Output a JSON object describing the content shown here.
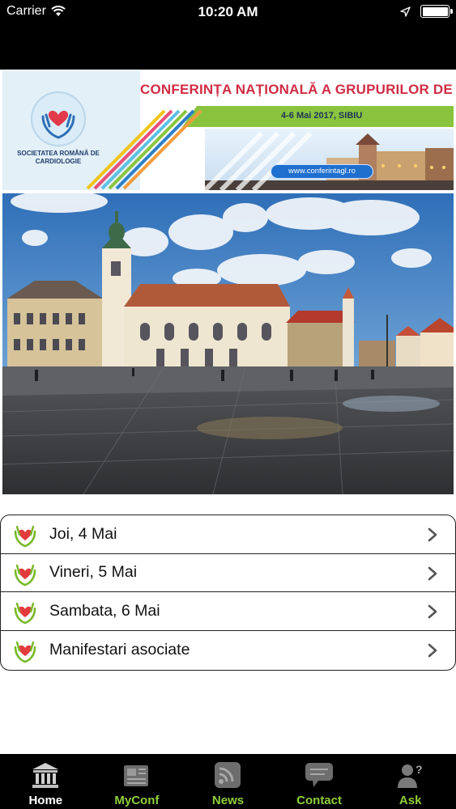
{
  "status_bar": {
    "carrier": "Carrier",
    "time": "10:20 AM",
    "battery_level": 1.0
  },
  "banner": {
    "society_name": "SOCIETATEA ROMÂNĂ DE CARDIOLOGIE",
    "title": "CONFERINȚA NAȚIONALĂ A GRUPURILOR DE LUCRU",
    "dates": "4-6 Mai 2017, SIBIU",
    "url": "www.conferintagl.ro",
    "title_color": "#d12c44",
    "accent_green": "#8ac43f"
  },
  "photo": {
    "subject": "Sibiu large square panorama"
  },
  "menu": {
    "items": [
      {
        "label": "Joi, 4 Mai",
        "icon": "heart-hands-icon"
      },
      {
        "label": "Vineri, 5 Mai",
        "icon": "heart-hands-icon"
      },
      {
        "label": "Sambata, 6 Mai",
        "icon": "heart-hands-icon"
      },
      {
        "label": "Manifestari asociate",
        "icon": "heart-hands-icon"
      }
    ]
  },
  "tab_bar": {
    "tabs": [
      {
        "label": "Home",
        "icon": "building-icon",
        "active": true
      },
      {
        "label": "MyConf",
        "icon": "newspaper-icon",
        "active": false
      },
      {
        "label": "News",
        "icon": "rss-icon",
        "active": false
      },
      {
        "label": "Contact",
        "icon": "speech-bubble-icon",
        "active": false
      },
      {
        "label": "Ask",
        "icon": "person-question-icon",
        "active": false
      }
    ],
    "active_color": "#ffffff",
    "inactive_color": "#8fcf3c"
  }
}
